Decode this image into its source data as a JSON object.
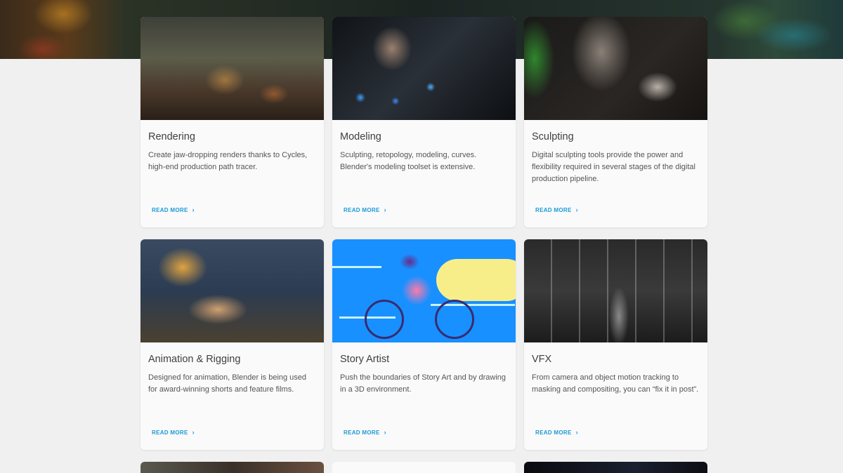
{
  "cards": [
    {
      "title": "Rendering",
      "desc": "Create jaw-dropping renders thanks to Cycles, high-end production path tracer.",
      "more": "READ MORE",
      "image": "rendering-thumbnail"
    },
    {
      "title": "Modeling",
      "desc": "Sculpting, retopology, modeling, curves. Blender's modeling toolset is extensive.",
      "more": "READ MORE",
      "image": "modeling-thumbnail"
    },
    {
      "title": "Sculpting",
      "desc": "Digital sculpting tools provide the power and flexibility required in several stages of the digital production pipeline.",
      "more": "READ MORE",
      "image": "sculpting-thumbnail"
    },
    {
      "title": "Animation & Rigging",
      "desc": "Designed for animation, Blender is being used for award-winning shorts and feature films.",
      "more": "READ MORE",
      "image": "animation-thumbnail"
    },
    {
      "title": "Story Artist",
      "desc": "Push the boundaries of Story Art and by drawing in a 3D environment.",
      "more": "READ MORE",
      "image": "story-artist-thumbnail"
    },
    {
      "title": "VFX",
      "desc": "From camera and object motion tracking to masking and compositing, you can “fix it in post”.",
      "more": "READ MORE",
      "image": "vfx-thumbnail"
    }
  ],
  "chevron": "›"
}
